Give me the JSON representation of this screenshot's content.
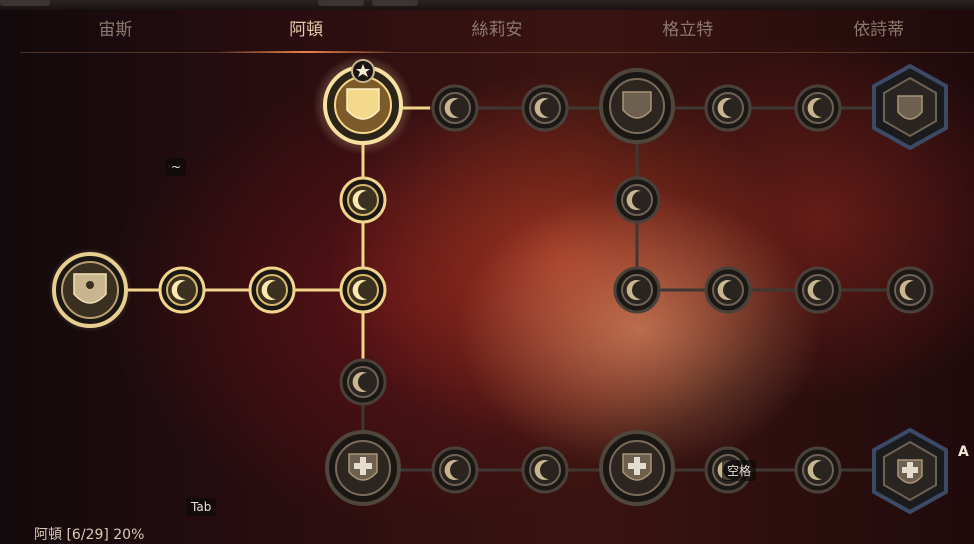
{
  "tabs": [
    {
      "label": "宙斯",
      "active": false
    },
    {
      "label": "阿頓",
      "active": true
    },
    {
      "label": "絲莉安",
      "active": false
    },
    {
      "label": "格立特",
      "active": false
    },
    {
      "label": "依詩蒂",
      "active": false
    }
  ],
  "hints": {
    "tilde": "~",
    "tab": "Tab",
    "space": "空格",
    "a_key": "A"
  },
  "status": {
    "text": "阿頓 [6/29] 20%"
  },
  "colors": {
    "active_line": "#f2d48a",
    "inactive_line": "#4a423a",
    "accent": "#e8824a"
  }
}
